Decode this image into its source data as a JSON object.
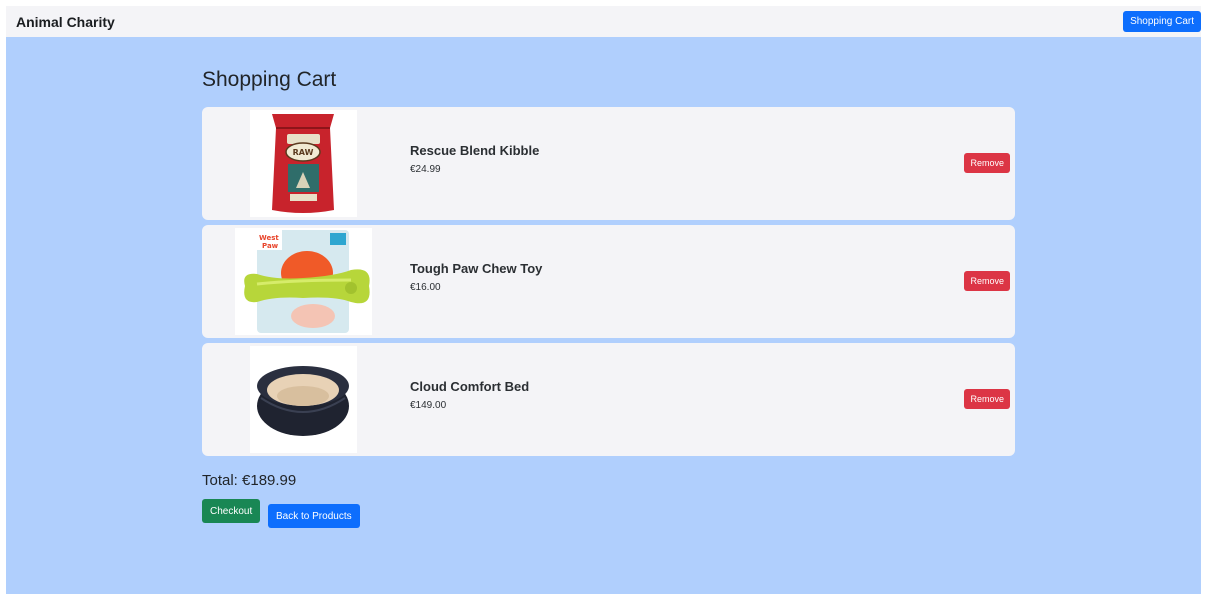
{
  "navbar": {
    "brand": "Animal Charity",
    "cart_button": "Shopping Cart"
  },
  "page": {
    "title": "Shopping Cart"
  },
  "cart": {
    "items": [
      {
        "name": "Rescue Blend Kibble",
        "price": "€24.99",
        "remove_label": "Remove",
        "image": "kibble-bag-image"
      },
      {
        "name": "Tough Paw Chew Toy",
        "price": "€16.00",
        "remove_label": "Remove",
        "image": "chew-toy-image"
      },
      {
        "name": "Cloud Comfort Bed",
        "price": "€149.00",
        "remove_label": "Remove",
        "image": "pet-bed-image"
      }
    ],
    "total": "Total: €189.99",
    "checkout_label": "Checkout",
    "back_label": "Back to Products"
  },
  "colors": {
    "background": "#b0cffd",
    "primary": "#0d6efd",
    "danger": "#dc3545",
    "success": "#198754"
  }
}
